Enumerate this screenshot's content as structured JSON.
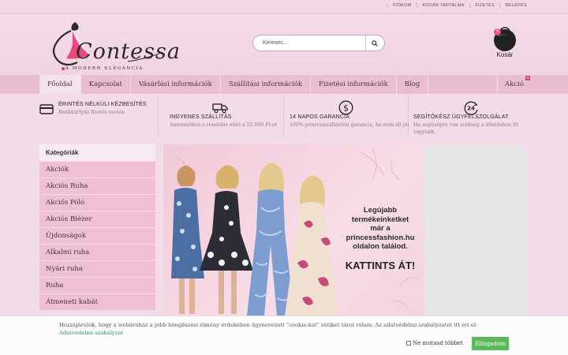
{
  "topbar": {
    "links": [
      "FIÓKOM",
      "KOSÁR TARTALMA",
      "FIZETÉS",
      "BELÉPÉS"
    ]
  },
  "logo": {
    "name": "Contessa",
    "tagline": "A MODERN ELEGANCIA"
  },
  "search": {
    "placeholder": "Keresés..."
  },
  "cart": {
    "label": "Kosár",
    "count": "0"
  },
  "nav": {
    "items": [
      "Főoldal",
      "Kapcsolat",
      "Vásárlási információk",
      "Szállítási információk",
      "Fizetési információk",
      "Blog"
    ],
    "sale": "Akció",
    "sale_badge": "%"
  },
  "features": [
    {
      "icon": "credit-card-icon",
      "title": "ÉRINTÉS NÉLKÜLI KÉZBESÍTÉS",
      "desc": "Bankkártyás fizetés esetén"
    },
    {
      "icon": "truck-icon",
      "title": "INGYENES SZÁLLÍTÁS",
      "desc": "Amennyiben a rendelés eléri a 25.000 Ft-ot"
    },
    {
      "icon": "dollar-icon",
      "title": "14 NAPOS GARANCIA",
      "desc": "100% pénzvisszafizetési garancia, ha nem áll jól"
    },
    {
      "icon": "24h-icon",
      "title": "SEGÍTŐKÉSZ ÜGYFÉLSZOLGÁLAT",
      "desc": "Ha segítségre van szükség a döntésben itt vagyunk."
    }
  ],
  "categories": {
    "heading": "Kategóriák",
    "items": [
      "Akciók",
      "Akciós Ruha",
      "Akciós Póló",
      "Akciós Blézer",
      "Újdonságok",
      "Alkalmi ruha",
      "Nyári ruha",
      "Ruha",
      "Átmeneti kabát"
    ]
  },
  "banner": {
    "lines": [
      "Legújabb",
      "termékeinketket",
      "már a",
      "princessfashion.hu",
      "oldalon találod."
    ],
    "cta": "KATTINTS ÁT!"
  },
  "cookie": {
    "message": "Hozzájárulok, hogy a webáruház a jobb böngészési élmény érdekében ügynevezett \"cookie-kat\" sütiket tárol rólam. Az adatvédelmi szabályzatot itt éri el: ",
    "link": "Adatvédelmi szabályzat",
    "checkbox_label": "Ne mutasd többet",
    "accept": "Elfogadom"
  },
  "colors": {
    "background": "#f3dbe8",
    "nav": "#eabdd3",
    "accent": "#d3457a",
    "accept": "#5cb85c"
  }
}
